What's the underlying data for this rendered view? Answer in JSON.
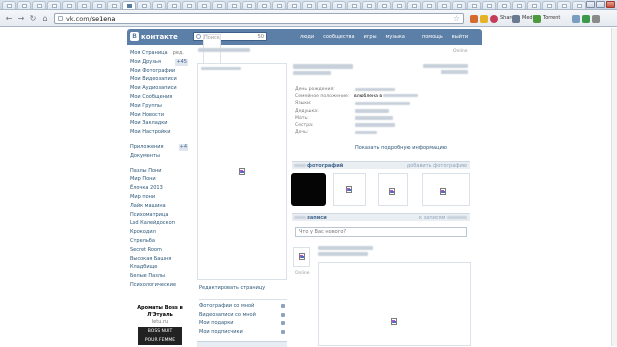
{
  "browser": {
    "url_host": "vk.com/",
    "url_path": "se1ena",
    "extensions": {
      "share_label": "Share",
      "media_label": "Media",
      "torrent_label": "Torrent"
    }
  },
  "vk": {
    "logo_text": "контакте",
    "logo_badge": "В",
    "search_placeholder": "Поиск",
    "search_count": "50",
    "nav": [
      "люди",
      "сообщества",
      "игры",
      "музыка",
      "помощь",
      "выйти"
    ],
    "sidebar": [
      {
        "label": "Моя Страница",
        "extra": "ред."
      },
      {
        "label": "Мои Друзья",
        "badge": "+45"
      },
      {
        "label": "Мои Фотографии"
      },
      {
        "label": "Мои Видеозаписи"
      },
      {
        "label": "Мои Аудиозаписи"
      },
      {
        "label": "Мои Сообщения"
      },
      {
        "label": "Мои Группы"
      },
      {
        "label": "Мои Новости"
      },
      {
        "label": "Мои Закладки"
      },
      {
        "label": "Мои Настройки"
      }
    ],
    "sidebar2": [
      {
        "label": "Приложения",
        "badge": "+4"
      },
      {
        "label": "Документы"
      }
    ],
    "apps": [
      "Пазлы Пони",
      "Мир Пони",
      "Ёлочка 2013",
      "Мир пони",
      "Лайк машина",
      "Психоматрица",
      "Lsd Калейдоскоп",
      "Крокодил",
      "Стрельба",
      "Secret Room",
      "Высокая Башня",
      "Кладбище",
      "Белые Пазлы",
      "Психологические"
    ],
    "ad": {
      "title_line1": "Ароматы Boss в",
      "title_line2": "Л'Этуаль",
      "url": "letu.ru",
      "img_line1": "BOSS NUIT",
      "img_line2": "POUR FEMME"
    },
    "profile": {
      "status_online": "Online",
      "edit_link": "Редактировать страницу",
      "links": [
        "Фотографии со мной",
        "Видеозаписи со мной",
        "Мои подарки",
        "Мои подписчики"
      ],
      "info_labels": [
        "День рождения:",
        "Семейное положение:",
        "Языки:",
        "Дедушка:",
        "Мать:",
        "Сестра:",
        "Дочь:"
      ],
      "relationship_value": "влюблена в",
      "show_full": "Показать подробную информацию",
      "photos_header": "фотографий",
      "photos_action": "добавить фотографию",
      "wall_header": "записи",
      "wall_action": "к записям",
      "wall_placeholder": "Что у Вас нового?",
      "post_online": "Online"
    }
  }
}
